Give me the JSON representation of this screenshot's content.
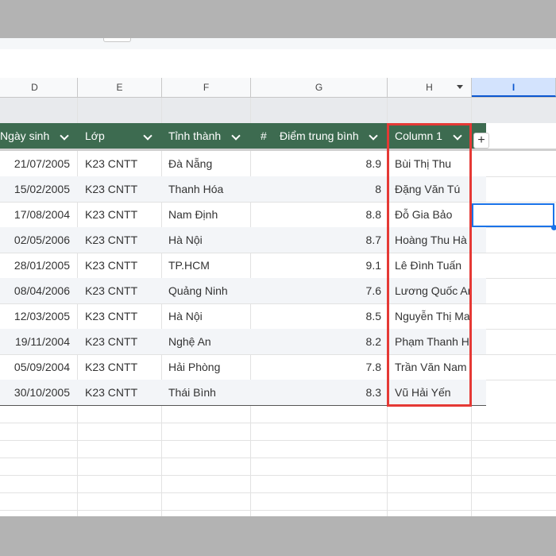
{
  "columns": [
    {
      "letter": "D"
    },
    {
      "letter": "E"
    },
    {
      "letter": "F"
    },
    {
      "letter": "G"
    },
    {
      "letter": "H"
    },
    {
      "letter": "I"
    }
  ],
  "table": {
    "headers": {
      "birth": "Ngày sinh",
      "class": "Lớp",
      "province": "Tỉnh thành",
      "number_icon": "#",
      "score": "Điểm trung bình",
      "col1": "Column 1"
    },
    "rows": [
      {
        "birth": "21/07/2005",
        "class": "K23 CNTT",
        "province": "Đà Nẵng",
        "score": "8.9",
        "col1": "Bùi Thị Thu"
      },
      {
        "birth": "15/02/2005",
        "class": "K23 CNTT",
        "province": "Thanh Hóa",
        "score": "8",
        "col1": "Đặng Văn Tú"
      },
      {
        "birth": "17/08/2004",
        "class": "K23 CNTT",
        "province": "Nam Định",
        "score": "8.8",
        "col1": "Đỗ Gia Bảo"
      },
      {
        "birth": "02/05/2006",
        "class": "K23 CNTT",
        "province": "Hà Nội",
        "score": "8.7",
        "col1": "Hoàng Thu Hà"
      },
      {
        "birth": "28/01/2005",
        "class": "K23 CNTT",
        "province": "TP.HCM",
        "score": "9.1",
        "col1": "Lê Đình Tuấn"
      },
      {
        "birth": "08/04/2006",
        "class": "K23 CNTT",
        "province": "Quảng Ninh",
        "score": "7.6",
        "col1": "Lương Quốc An"
      },
      {
        "birth": "12/03/2005",
        "class": "K23 CNTT",
        "province": "Hà Nội",
        "score": "8.5",
        "col1": "Nguyễn Thị Mai"
      },
      {
        "birth": "19/11/2004",
        "class": "K23 CNTT",
        "province": "Nghệ An",
        "score": "8.2",
        "col1": "Phạm Thanh Hù"
      },
      {
        "birth": "05/09/2004",
        "class": "K23 CNTT",
        "province": "Hải Phòng",
        "score": "7.8",
        "col1": "Trần Văn Nam"
      },
      {
        "birth": "30/10/2005",
        "class": "K23 CNTT",
        "province": "Thái Bình",
        "score": "8.3",
        "col1": "Vũ Hải Yến"
      }
    ]
  },
  "add_column_label": "+",
  "colors": {
    "table_header": "#3d6b50",
    "highlight": "#e53935",
    "selection": "#1a73e8"
  }
}
